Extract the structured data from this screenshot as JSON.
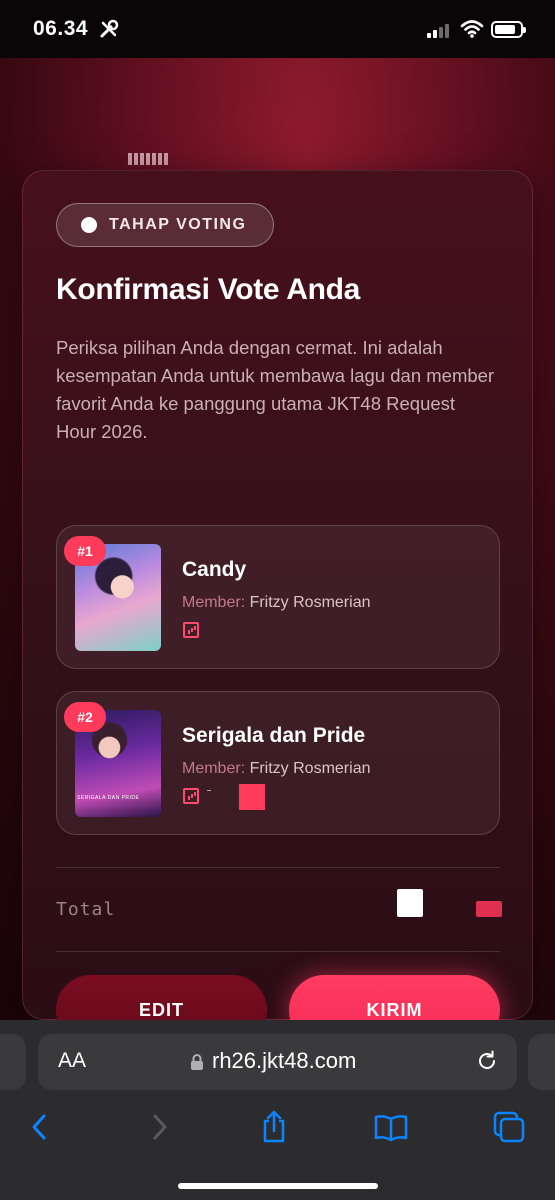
{
  "status_bar": {
    "time": "06.34"
  },
  "card": {
    "stage_badge": "TAHAP VOTING",
    "title": "Konfirmasi Vote Anda",
    "description": "Periksa pilihan Anda dengan cermat. Ini adalah kesempatan Anda untuk membawa lagu dan member favorit Anda ke panggung utama JKT48 Request Hour 2026.",
    "items": [
      {
        "rank": "#1",
        "song": "Candy",
        "member_label": "Member:",
        "member_name": "Fritzy Rosmerian"
      },
      {
        "rank": "#2",
        "song": "Serigala dan Pride",
        "member_label": "Member:",
        "member_name": "Fritzy Rosmerian",
        "thumb_caption": "SERIGALA DAN PRIDE"
      }
    ],
    "total_label": "Total",
    "edit_button": "EDIT",
    "send_button": "KIRIM"
  },
  "browser": {
    "text_size_label": "AA",
    "url": "rh26.jkt48.com"
  },
  "icons": {
    "tools": "tools-icon",
    "signal": "signal-icon",
    "wifi": "wifi-icon",
    "battery": "battery-icon",
    "lock": "lock-icon",
    "reload": "reload-icon",
    "back": "back-icon",
    "forward": "forward-icon",
    "share": "share-icon",
    "bookmarks": "bookmarks-icon",
    "tabs": "tabs-icon",
    "chart": "chart-icon"
  },
  "colors": {
    "accent": "#ff3b5c",
    "ios_blue": "#0a84ff"
  }
}
